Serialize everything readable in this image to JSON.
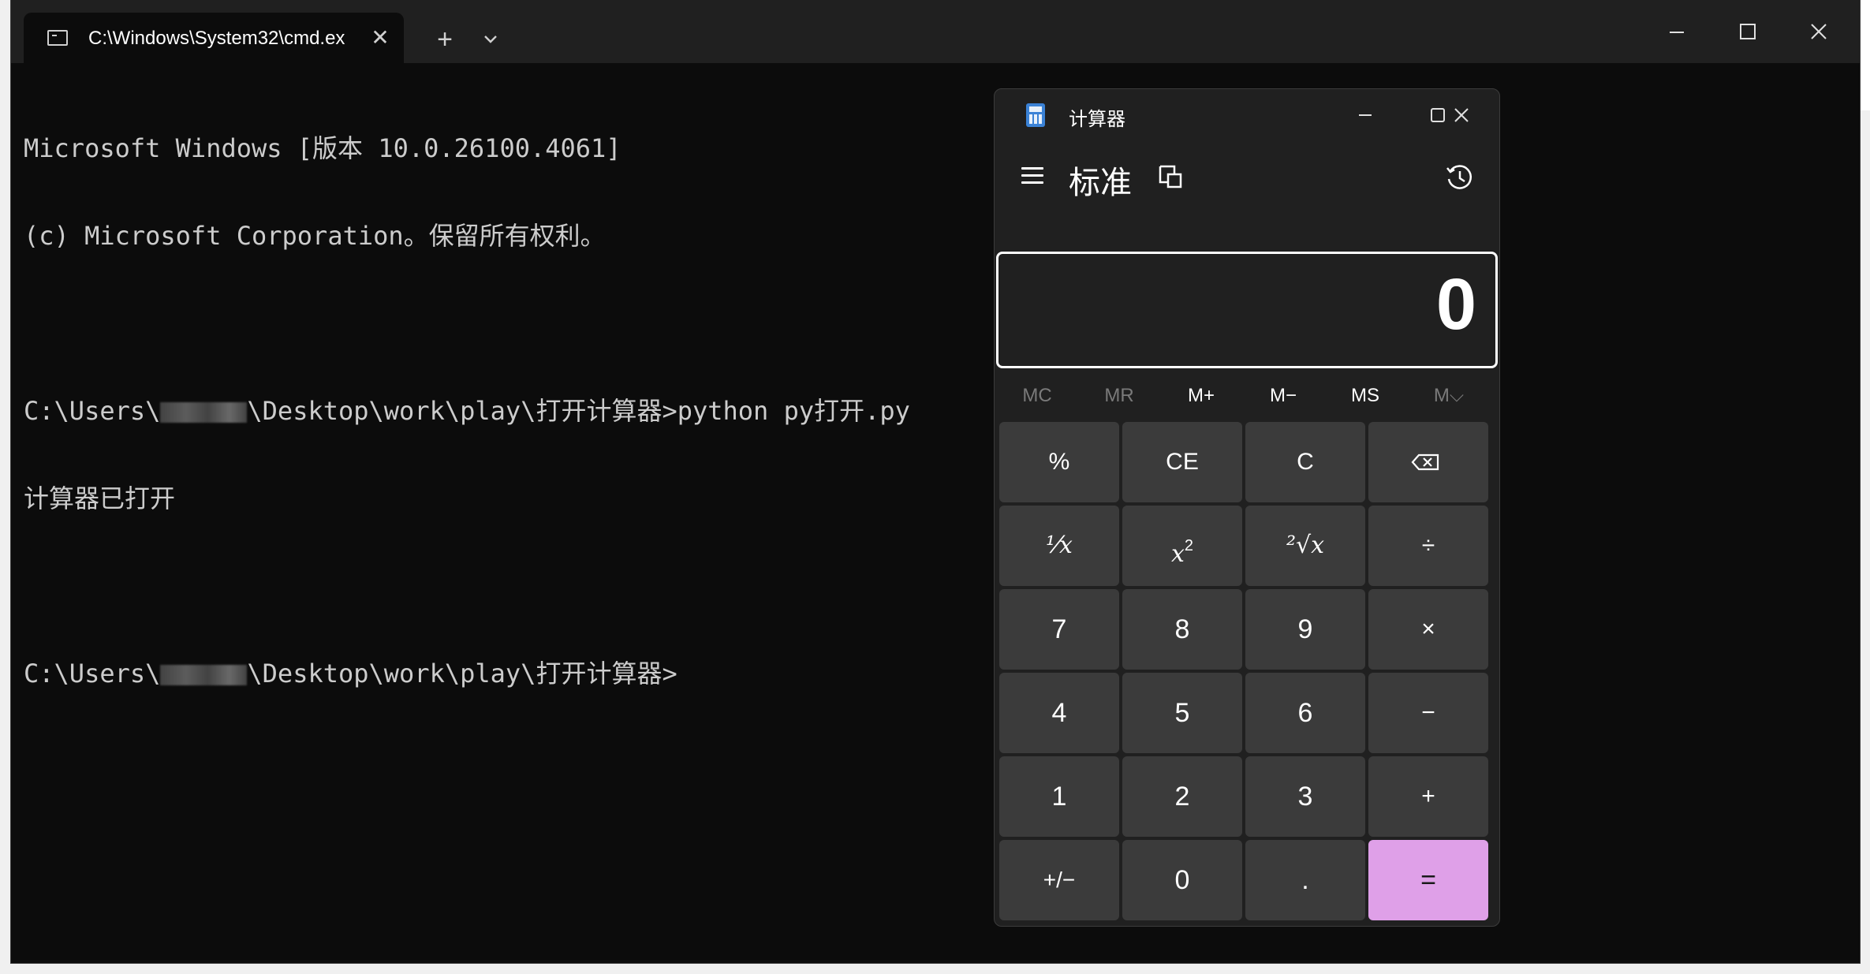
{
  "terminal": {
    "tab_title": "C:\\Windows\\System32\\cmd.ex",
    "tab_close": "✕",
    "new_tab": "+",
    "window_controls": {
      "minimize": "—",
      "maximize": "☐",
      "close": "✕"
    },
    "lines": [
      "Microsoft Windows [版本 10.0.26100.4061]",
      "(c) Microsoft Corporation。保留所有权利。",
      "",
      {
        "before": "C:\\Users\\",
        "after": "\\Desktop\\work\\play\\打开计算器>python py打开.py"
      },
      "计算器已打开",
      "",
      {
        "before": "C:\\Users\\",
        "after": "\\Desktop\\work\\play\\打开计算器>"
      }
    ]
  },
  "calculator": {
    "title": "计算器",
    "mode": "标准",
    "window_controls": {
      "minimize": "—",
      "maximize": "☐",
      "close": "✕"
    },
    "display": "0",
    "memory": [
      "MC",
      "MR",
      "M+",
      "M−",
      "MS",
      "M⌵"
    ],
    "keys": {
      "percent": "%",
      "ce": "CE",
      "c": "C",
      "backspace": "⌫",
      "reciprocal": "⅟x",
      "square_base": "x",
      "square_exp": "2",
      "sqrt_root": "²√x",
      "divide": "÷",
      "seven": "7",
      "eight": "8",
      "nine": "9",
      "multiply": "×",
      "four": "4",
      "five": "5",
      "six": "6",
      "minus": "−",
      "one": "1",
      "two": "2",
      "three": "3",
      "plus": "+",
      "negate": "+/−",
      "zero": "0",
      "decimal": ".",
      "equals": "="
    }
  }
}
